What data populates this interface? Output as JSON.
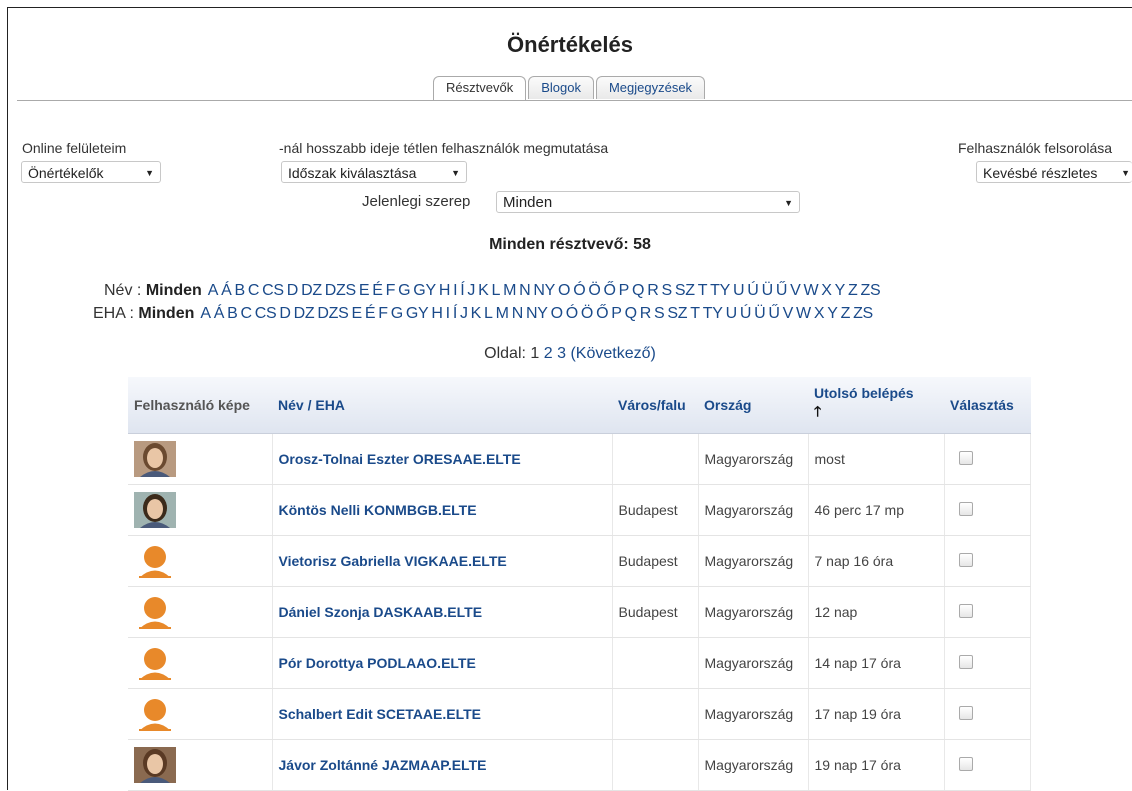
{
  "page_title": "Önértékelés",
  "tabs": [
    {
      "label": "Résztvevők",
      "active": true
    },
    {
      "label": "Blogok",
      "active": false
    },
    {
      "label": "Megjegyzések",
      "active": false
    }
  ],
  "filters": {
    "online_label": "Online felületeim",
    "online_value": "Önértékelők",
    "inactive_label": "-nál hosszabb ideje tétlen felhasználók megmutatása",
    "inactive_value": "Időszak kiválasztása",
    "list_label": "Felhasználók felsorolása",
    "list_value": "Kevésbé részletes",
    "role_label": "Jelenlegi szerep",
    "role_value": "Minden"
  },
  "participants_heading": "Minden résztvevő: 58",
  "alphabet": {
    "name_label": "Név",
    "eha_label": "EHA",
    "all_label": "Minden",
    "letters": [
      "A",
      "Á",
      "B",
      "C",
      "CS",
      "D",
      "DZ",
      "DZS",
      "E",
      "É",
      "F",
      "G",
      "GY",
      "H",
      "I",
      "Í",
      "J",
      "K",
      "L",
      "M",
      "N",
      "NY",
      "O",
      "Ó",
      "Ö",
      "Ő",
      "P",
      "Q",
      "R",
      "S",
      "SZ",
      "T",
      "TY",
      "U",
      "Ú",
      "Ü",
      "Ű",
      "V",
      "W",
      "X",
      "Y",
      "Z",
      "ZS"
    ]
  },
  "pager": {
    "label": "Oldal:",
    "pages": [
      "1",
      "2",
      "3"
    ],
    "next": "(Következő)"
  },
  "table": {
    "headers": {
      "photo": "Felhasználó képe",
      "name": "Név / EHA",
      "city": "Város/falu",
      "country": "Ország",
      "last_login": "Utolsó belépés",
      "select": "Választás"
    },
    "rows": [
      {
        "photo": "photo-woman-1",
        "name": "Orosz-Tolnai Eszter ORESAAE.ELTE",
        "city": "",
        "country": "Magyarország",
        "last": "most"
      },
      {
        "photo": "photo-woman-2",
        "name": "Köntös Nelli KONMBGB.ELTE",
        "city": "Budapest",
        "country": "Magyarország",
        "last": "46 perc 17 mp"
      },
      {
        "photo": "default-avatar-icon",
        "name": "Vietorisz Gabriella VIGKAAE.ELTE",
        "city": "Budapest",
        "country": "Magyarország",
        "last": "7 nap 16 óra"
      },
      {
        "photo": "default-avatar-icon",
        "name": "Dániel Szonja DASKAAB.ELTE",
        "city": "Budapest",
        "country": "Magyarország",
        "last": "12 nap"
      },
      {
        "photo": "default-avatar-icon",
        "name": "Pór Dorottya PODLAAO.ELTE",
        "city": "",
        "country": "Magyarország",
        "last": "14 nap 17 óra"
      },
      {
        "photo": "default-avatar-icon",
        "name": "Schalbert Edit SCETAAE.ELTE",
        "city": "",
        "country": "Magyarország",
        "last": "17 nap 19 óra"
      },
      {
        "photo": "photo-woman-3",
        "name": "Jávor Zoltánné JAZMAAP.ELTE",
        "city": "",
        "country": "Magyarország",
        "last": "19 nap 17 óra"
      }
    ]
  },
  "colors": {
    "link": "#1a4a8a",
    "avatar": "#e8892a"
  }
}
